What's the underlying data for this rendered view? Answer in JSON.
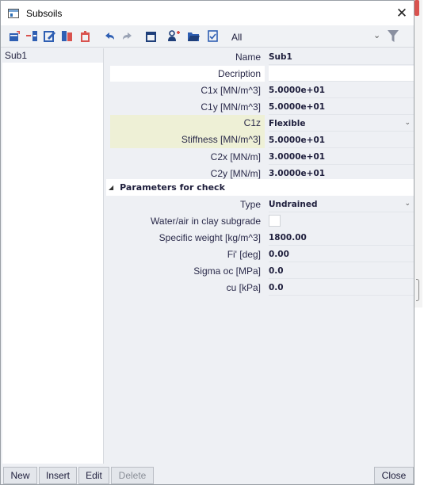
{
  "window": {
    "title": "Subsoils",
    "close_glyph": "✕"
  },
  "toolbar": {
    "icons": [
      "new-record-icon",
      "insert-record-icon",
      "edit-icon",
      "copy-icon",
      "delete-icon",
      "undo-icon",
      "redo-icon",
      "print-icon",
      "users-icon",
      "open-folder-icon",
      "check-document-icon",
      "filter-icon"
    ],
    "filter_value": "All"
  },
  "list": {
    "items": [
      "Sub1"
    ]
  },
  "properties": {
    "name": {
      "label": "Name",
      "value": "Sub1"
    },
    "description": {
      "label": "Decription",
      "value": ""
    },
    "c1x": {
      "label": "C1x [MN/m^3]",
      "value": "5.0000e+01"
    },
    "c1y": {
      "label": "C1y [MN/m^3]",
      "value": "5.0000e+01"
    },
    "c1z": {
      "label": "C1z",
      "value": "Flexible"
    },
    "stiffness": {
      "label": "Stiffness [MN/m^3]",
      "value": "5.0000e+01"
    },
    "c2x": {
      "label": "C2x [MN/m]",
      "value": "3.0000e+01"
    },
    "c2y": {
      "label": "C2y [MN/m]",
      "value": "3.0000e+01"
    }
  },
  "check_section": {
    "title": "Parameters for check",
    "type": {
      "label": "Type",
      "value": "Undrained"
    },
    "water_air": {
      "label": "Water/air in clay subgrade",
      "checked": false
    },
    "specific_weight": {
      "label": "Specific weight [kg/m^3]",
      "value": "1800.00"
    },
    "fi": {
      "label": "Fi' [deg]",
      "value": "0.00"
    },
    "sigma_oc": {
      "label": "Sigma oc [MPa]",
      "value": "0.0"
    },
    "cu": {
      "label": "cu [kPa]",
      "value": "0.0"
    }
  },
  "buttons": {
    "new": "New",
    "insert": "Insert",
    "edit": "Edit",
    "delete": "Delete",
    "close": "Close"
  },
  "colors": {
    "accent": "#2f5fb3",
    "highlight_row": "#eef0d6",
    "delete_red": "#d9534f",
    "panel_bg": "#eef0f4"
  }
}
